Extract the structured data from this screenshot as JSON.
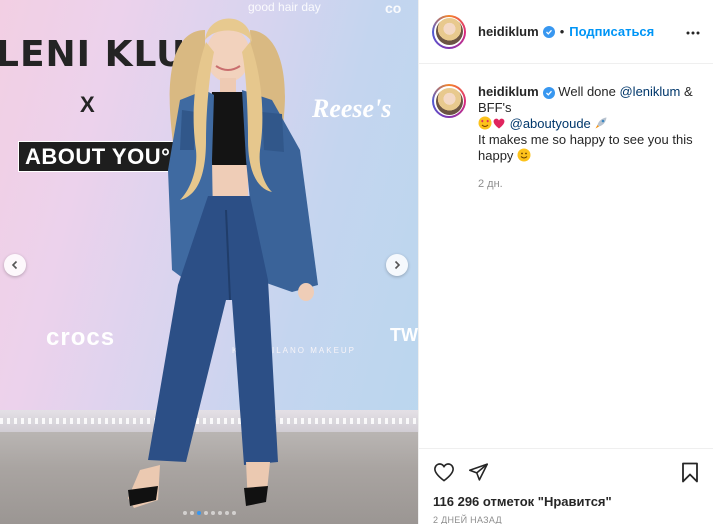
{
  "post": {
    "photo": {
      "alt_brands": {
        "leni_klum": "LENI KLUM",
        "x": "X",
        "about_you": "ABOUT YOU°",
        "crocs": "crocs",
        "reeses": "Reese's",
        "top_text_1": "good hair day",
        "top_text_2": "co",
        "tw": "TW",
        "kiko": "KIKO MILANO MAKEUP"
      },
      "carousel": {
        "total_slides": 8,
        "active_slide": 3
      }
    },
    "header": {
      "username": "heidiklum",
      "verified": true,
      "separator": "•",
      "follow_label": "Подписаться",
      "more_icon": "more-horizontal-icon"
    },
    "caption": {
      "username": "heidiklum",
      "line1_text": " Well done ",
      "mention1": "@leniklum",
      "line1_tail": " & BFF's",
      "mention2": "@aboutyoude",
      "line3": "It makes me so happy to see you this happy",
      "age": "2 дн."
    },
    "actions": {
      "like_icon": "heart-icon",
      "share_icon": "send-icon",
      "save_icon": "bookmark-icon"
    },
    "likes_text": "116 296 отметок \"Нравится\"",
    "timestamp": "2 ДНЕЙ НАЗАД"
  },
  "colors": {
    "accent": "#0095f6",
    "verified": "#3897f0",
    "link": "#00376b",
    "muted": "#8e8e8e"
  }
}
